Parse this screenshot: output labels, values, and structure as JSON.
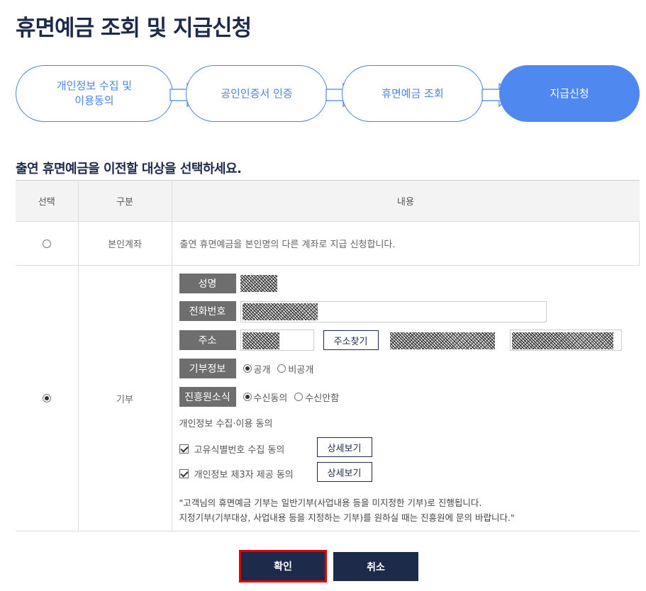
{
  "page_title": "휴면예금 조회 및 지급신청",
  "steps": [
    {
      "line1": "개인정보 수집 및",
      "line2": "이용동의",
      "active": false
    },
    {
      "line1": "공인인증서 인증",
      "line2": "",
      "active": false
    },
    {
      "line1": "휴면예금 조회",
      "line2": "",
      "active": false
    },
    {
      "line1": "지급신청",
      "line2": "",
      "active": true
    }
  ],
  "section_title": "출연 휴면예금을 이전할 대상을 선택하세요.",
  "table": {
    "headers": [
      "선택",
      "구분",
      "내용"
    ],
    "rows": [
      {
        "selected": false,
        "category": "본인계좌",
        "content": "출연 휴면예금을 본인명의 다른 계좌로 지급 신청합니다."
      },
      {
        "selected": true,
        "category": "기부"
      }
    ]
  },
  "donation_form": {
    "name_label": "성명",
    "phone_label": "전화번호",
    "address_label": "주소",
    "address_search_button": "주소찾기",
    "donation_info_label": "기부정보",
    "donation_info_options": [
      {
        "label": "공개",
        "checked": true
      },
      {
        "label": "비공개",
        "checked": false
      }
    ],
    "notice_label": "진흥원소식",
    "notice_options": [
      {
        "label": "수신동의",
        "checked": true
      },
      {
        "label": "수신안함",
        "checked": false
      }
    ],
    "privacy_title": "개인정보 수집·이용 동의",
    "consents": [
      {
        "label": "고유식별번호 수집 동의",
        "checked": true,
        "button": "상세보기"
      },
      {
        "label": "개인정보 제3자 제공 동의",
        "checked": true,
        "button": "상세보기"
      }
    ],
    "note_line1": "\"고객님의 휴면예금 기부는 일반기부(사업내용 등을 미지정한 기부)로 진행됩니다.",
    "note_line2": "지정기부(기부대상, 사업내용 등을 지정하는 기부)를 원하실 때는 진흥원에 문의 바랍니다.\""
  },
  "buttons": {
    "confirm": "확인",
    "cancel": "취소"
  },
  "colors": {
    "navy": "#1e2a4a",
    "step_blue": "#4f88ef",
    "label_gray": "#6e6e6e",
    "highlight_red": "#e00000"
  }
}
